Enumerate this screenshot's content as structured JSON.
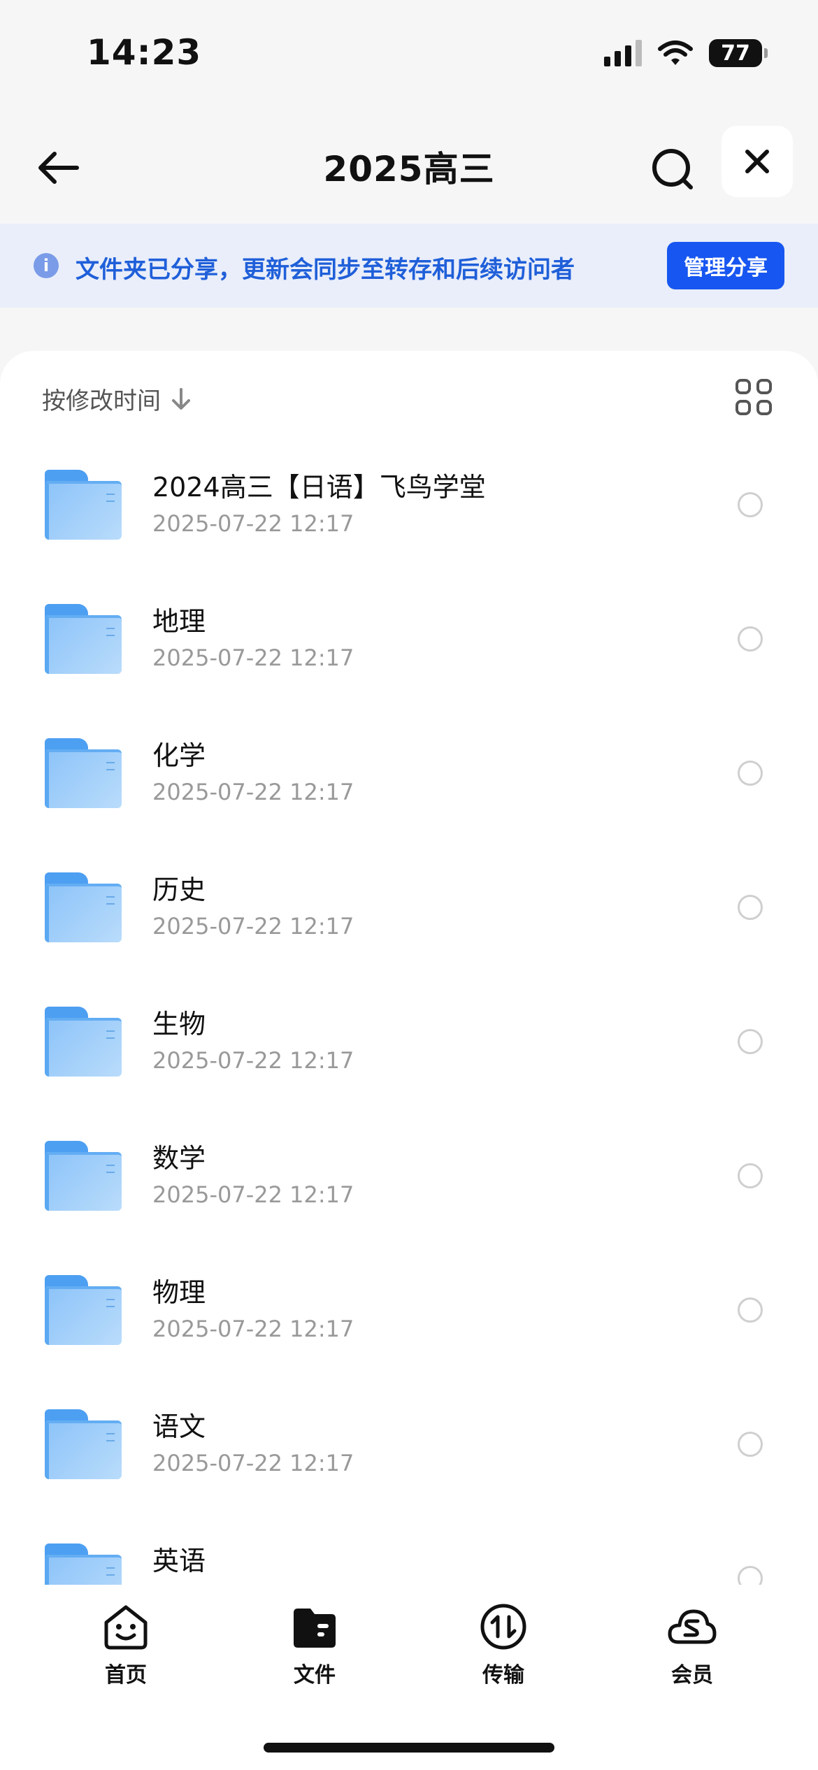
{
  "status_bar": {
    "time": "14:23",
    "battery": "77"
  },
  "nav": {
    "title": "2025高三",
    "icons": {
      "back": "back-arrow-icon",
      "search": "search-icon",
      "close": "close-icon"
    }
  },
  "share_banner": {
    "text": "文件夹已分享，更新会同步至转存和后续访问者",
    "button": "管理分享"
  },
  "sort": {
    "label": "按修改时间"
  },
  "files": [
    {
      "name": "2024高三【日语】飞鸟学堂",
      "date": "2025-07-22 12:17"
    },
    {
      "name": "地理",
      "date": "2025-07-22 12:17"
    },
    {
      "name": "化学",
      "date": "2025-07-22 12:17"
    },
    {
      "name": "历史",
      "date": "2025-07-22 12:17"
    },
    {
      "name": "生物",
      "date": "2025-07-22 12:17"
    },
    {
      "name": "数学",
      "date": "2025-07-22 12:17"
    },
    {
      "name": "物理",
      "date": "2025-07-22 12:17"
    },
    {
      "name": "语文",
      "date": "2025-07-22 12:17"
    },
    {
      "name": "英语",
      "date": ""
    }
  ],
  "tabs": [
    {
      "label": "首页",
      "icon": "home-smile-icon"
    },
    {
      "label": "文件",
      "icon": "folder-icon"
    },
    {
      "label": "传输",
      "icon": "transfer-icon"
    },
    {
      "label": "会员",
      "icon": "vip-cloud-icon"
    }
  ],
  "colors": {
    "accent": "#1756f0",
    "banner_bg": "#e9eefa",
    "banner_text": "#1f5fd9",
    "folder": "#8ec4f9"
  }
}
